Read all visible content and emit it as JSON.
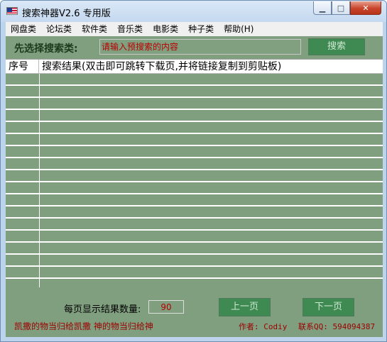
{
  "window": {
    "title": "搜索神器V2.6   专用版",
    "controls": {
      "minimize": "▁",
      "maximize": "□",
      "close": "✕"
    }
  },
  "menu": [
    "网盘类",
    "论坛类",
    "软件类",
    "音乐类",
    "电影类",
    "种子类",
    "帮助(H)"
  ],
  "search": {
    "label": "先选择搜索类:",
    "placeholder": "请输入预搜索的内容",
    "button": "搜索"
  },
  "results": {
    "columns": [
      "序号",
      "搜索结果(双击即可跳转下载页,并将链接复制到剪贴板)"
    ],
    "rows": []
  },
  "footer": {
    "count_label": "每页显示结果数量:",
    "count_value": "90",
    "prev_button": "上一页",
    "next_button": "下一页",
    "slogan": "凯撒的物当归给凯撒  神的物当归给神",
    "author": "作者: Codiy",
    "contact": "联系QQ: 594094387"
  },
  "colors": {
    "panel": "#809f7f",
    "button": "#3e8a52",
    "accent_text": "#9c0000"
  }
}
